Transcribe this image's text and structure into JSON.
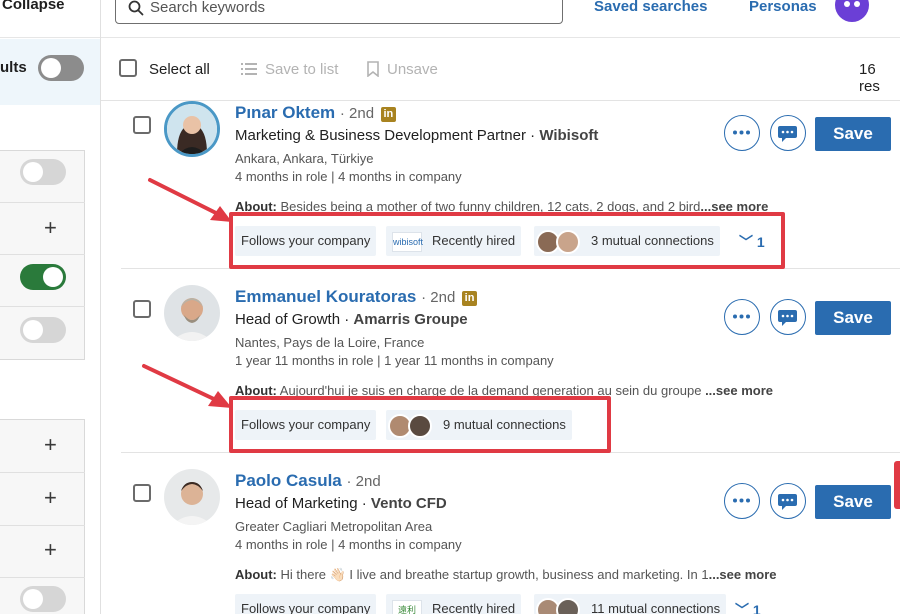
{
  "sidebar": {
    "collapse_label": "Collapse",
    "results_label": "ults"
  },
  "topbar": {
    "search_placeholder": "Search keywords",
    "saved_searches": "Saved searches",
    "personas": "Personas"
  },
  "actionbar": {
    "select_all": "Select all",
    "save_to_list": "Save to list",
    "unsave": "Unsave",
    "results_count": "16 res"
  },
  "leads": [
    {
      "name": "Pınar Oktem",
      "degree": "· 2nd",
      "title": "Marketing & Business Development Partner",
      "company": "Wibisoft",
      "location": "Ankara, Ankara, Türkiye",
      "tenure": "4 months in role | 4 months in company",
      "about_label": "About:",
      "about": "Besides being a mother of two funny children, 12 cats, 2 dogs, and 2 bird",
      "see_more": "...see more",
      "chip_follows": "Follows your company",
      "chip_hired": "Recently hired",
      "chip_hired_logo": "wibisoft",
      "chip_mutual": "3 mutual connections",
      "expand": "1"
    },
    {
      "name": "Emmanuel Kouratoras",
      "degree": "· 2nd",
      "title": "Head of Growth",
      "company": "Amarris Groupe",
      "location": "Nantes, Pays de la Loire, France",
      "tenure": "1 year 11 months in role | 1 year 11 months in company",
      "about_label": "About:",
      "about": "Aujourd'hui je suis en charge de la demand generation au sein du groupe",
      "see_more": " ...see more",
      "chip_follows": "Follows your company",
      "chip_mutual": "9 mutual connections"
    },
    {
      "name": "Paolo Casula",
      "degree": "· 2nd",
      "title": "Head of Marketing",
      "company": "Vento CFD",
      "location": "Greater Cagliari Metropolitan Area",
      "tenure": "4 months in role | 4 months in company",
      "about_label": "About:",
      "about": "Hi there 👋🏻 I live and breathe startup growth, business and marketing. In 1",
      "see_more": "...see more",
      "chip_follows": "Follows your company",
      "chip_hired": "Recently hired",
      "chip_hired_logo": "遠利",
      "chip_mutual": "11 mutual connections",
      "expand": "1"
    }
  ],
  "save_label": "Save",
  "colors": {
    "accent": "#2a6cb0",
    "highlight": "#e03a44",
    "toggle_on": "#2a7a3b",
    "chip_bg": "#eef3f8",
    "bot": "#6b3fd6"
  }
}
